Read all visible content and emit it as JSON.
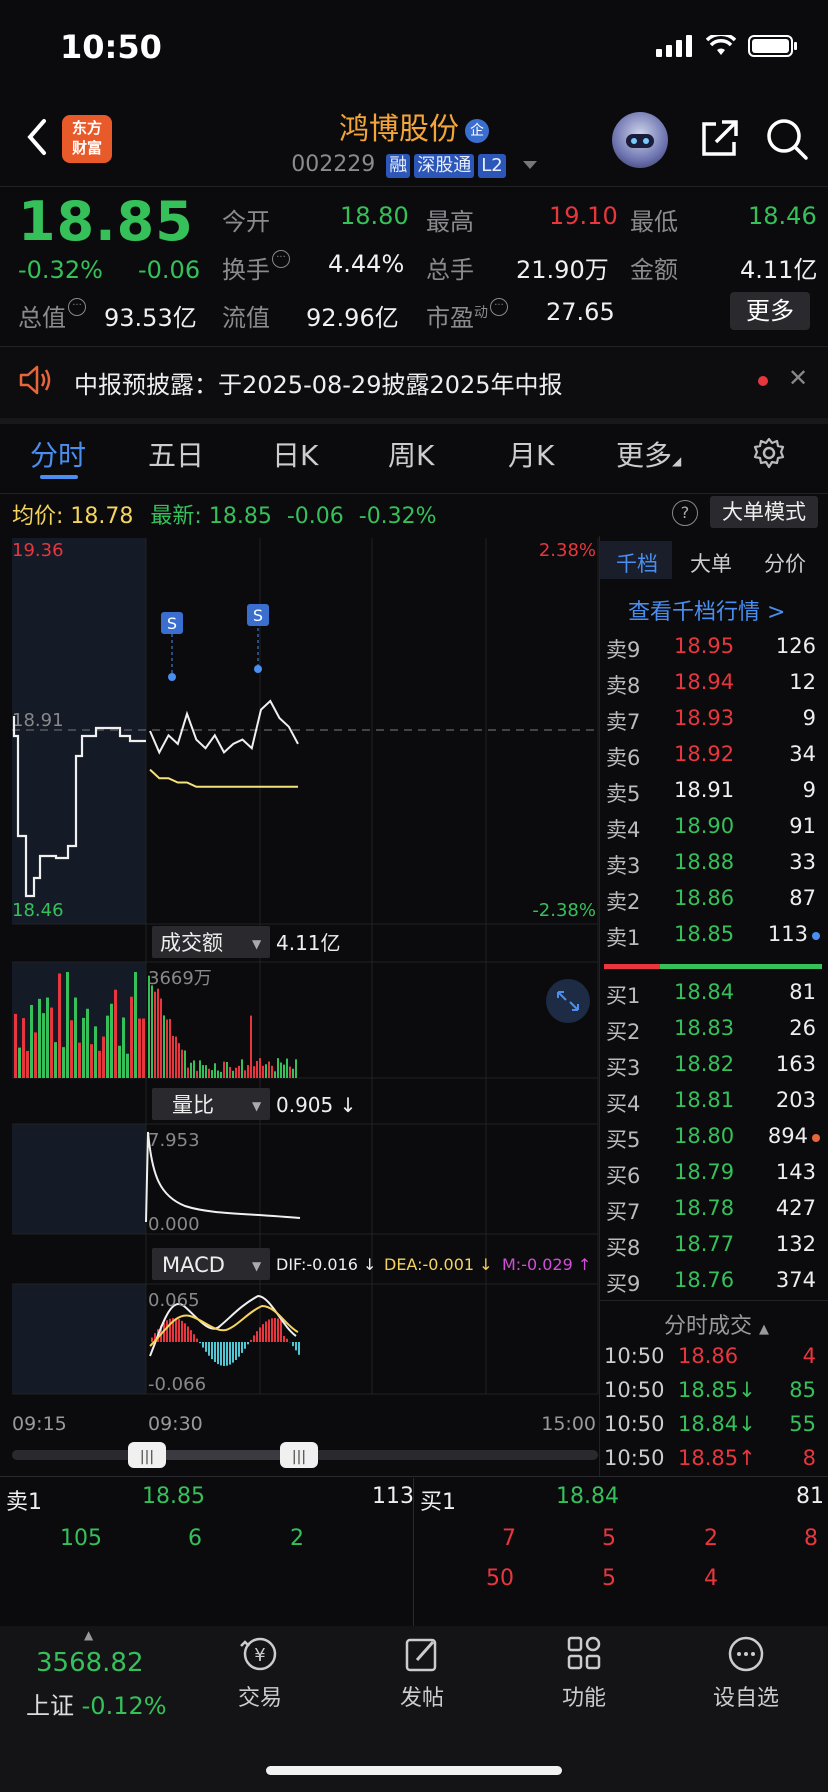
{
  "status_bar": {
    "time": "10:50"
  },
  "header": {
    "logo_line1": "东方",
    "logo_line2": "财富",
    "title": "鸿博股份",
    "title_badge": "企",
    "code": "002229",
    "tags": [
      "融",
      "深股通",
      "L2"
    ]
  },
  "quote": {
    "price": "18.85",
    "change_pct": "-0.32%",
    "change": "-0.06",
    "total_value_label": "总值",
    "total_value": "93.53亿",
    "fields": [
      {
        "label": "今开",
        "value": "18.80",
        "color": "green"
      },
      {
        "label": "最高",
        "value": "19.10",
        "color": "red"
      },
      {
        "label": "最低",
        "value": "18.46",
        "color": "green"
      },
      {
        "label": "换手",
        "value": "4.44%",
        "color": "white"
      },
      {
        "label": "总手",
        "value": "21.90万",
        "color": "white"
      },
      {
        "label": "金额",
        "value": "4.11亿",
        "color": "white"
      },
      {
        "label": "流值",
        "value": "92.96亿",
        "color": "white"
      },
      {
        "label": "市盈",
        "label_sup": "动",
        "value": "27.65",
        "color": "white"
      }
    ],
    "more_label": "更多"
  },
  "notice": {
    "text": "中报预披露：于2025-08-29披露2025年中报"
  },
  "tabs": [
    "分时",
    "五日",
    "日K",
    "周K",
    "月K",
    "更多"
  ],
  "summary": {
    "avg_label": "均价:",
    "avg_value": "18.78",
    "latest_label": "最新:",
    "latest_value": "18.85",
    "latest_change": "-0.06",
    "latest_pct": "-0.32%",
    "bigorder_label": "大单模式"
  },
  "chart": {
    "price_high": "19.36",
    "price_low": "18.46",
    "price_ref": "18.91",
    "pct_high": "2.38%",
    "pct_low": "-2.38%",
    "signal_label": "S",
    "vol_indicator": "成交额",
    "vol_value": "4.11亿",
    "vol_max": "3669万",
    "ratio_indicator": "量比",
    "ratio_value": "0.905 ↓",
    "ratio_max": "7.953",
    "ratio_min": "0.000",
    "macd_indicator": "MACD",
    "dif": "DIF:-0.016 ↓",
    "dea": "DEA:-0.001 ↓",
    "m": "M:-0.029 ↑",
    "macd_max": "0.065",
    "macd_min": "-0.066",
    "time_start": "09:15",
    "time_open": "09:30",
    "time_end": "15:00"
  },
  "chart_data": {
    "type": "line",
    "series": [
      {
        "name": "最新",
        "values": [
          18.91,
          18.86,
          18.9,
          18.88,
          18.95,
          18.89,
          18.87,
          18.9,
          18.86,
          18.88,
          18.89,
          18.87,
          18.96,
          18.98,
          18.94,
          18.92,
          18.88
        ]
      },
      {
        "name": "均价",
        "values": [
          18.82,
          18.8,
          18.8,
          18.79,
          18.79,
          18.78,
          18.78,
          18.78,
          18.78,
          18.78,
          18.78,
          18.78,
          18.78,
          18.78,
          18.78,
          18.78,
          18.78
        ]
      }
    ],
    "ylim": [
      18.46,
      19.36
    ]
  },
  "orderbook": {
    "tabs": [
      "千档",
      "大单",
      "分价"
    ],
    "link": "查看千档行情 >",
    "asks": [
      {
        "label": "卖9",
        "price": "18.95",
        "vol": "126",
        "color": "red"
      },
      {
        "label": "卖8",
        "price": "18.94",
        "vol": "12",
        "color": "red"
      },
      {
        "label": "卖7",
        "price": "18.93",
        "vol": "9",
        "color": "red"
      },
      {
        "label": "卖6",
        "price": "18.92",
        "vol": "34",
        "color": "red"
      },
      {
        "label": "卖5",
        "price": "18.91",
        "vol": "9",
        "color": "white"
      },
      {
        "label": "卖4",
        "price": "18.90",
        "vol": "91",
        "color": "green"
      },
      {
        "label": "卖3",
        "price": "18.88",
        "vol": "33",
        "color": "green"
      },
      {
        "label": "卖2",
        "price": "18.86",
        "vol": "87",
        "color": "green"
      },
      {
        "label": "卖1",
        "price": "18.85",
        "vol": "113",
        "color": "green"
      }
    ],
    "bids": [
      {
        "label": "买1",
        "price": "18.84",
        "vol": "81",
        "color": "green"
      },
      {
        "label": "买2",
        "price": "18.83",
        "vol": "26",
        "color": "green"
      },
      {
        "label": "买3",
        "price": "18.82",
        "vol": "163",
        "color": "green"
      },
      {
        "label": "买4",
        "price": "18.81",
        "vol": "203",
        "color": "green"
      },
      {
        "label": "买5",
        "price": "18.80",
        "vol": "894",
        "color": "green"
      },
      {
        "label": "买6",
        "price": "18.79",
        "vol": "143",
        "color": "green"
      },
      {
        "label": "买7",
        "price": "18.78",
        "vol": "427",
        "color": "green"
      },
      {
        "label": "买8",
        "price": "18.77",
        "vol": "132",
        "color": "green"
      },
      {
        "label": "买9",
        "price": "18.76",
        "vol": "374",
        "color": "green"
      }
    ],
    "ticks_title": "分时成交",
    "ticks": [
      {
        "time": "10:50",
        "price": "18.86",
        "vol": "4",
        "color": "red"
      },
      {
        "time": "10:50",
        "price": "18.85↓",
        "vol": "85",
        "color": "green"
      },
      {
        "time": "10:50",
        "price": "18.84↓",
        "vol": "55",
        "color": "green"
      },
      {
        "time": "10:50",
        "price": "18.85↑",
        "vol": "8",
        "color": "red"
      }
    ]
  },
  "levels": {
    "sell_label": "卖1",
    "sell_price": "18.85",
    "sell_vol": "113",
    "buy_label": "买1",
    "buy_price": "18.84",
    "buy_vol": "81",
    "sell_queue": [
      "105",
      "6",
      "2"
    ],
    "buy_queue_row1": [
      "7",
      "5",
      "2",
      "8"
    ],
    "buy_queue_row2": [
      "50",
      "5",
      "4"
    ]
  },
  "nav": {
    "index_value": "3568.82",
    "index_name": "上证",
    "index_change": "-0.12%",
    "items": [
      "交易",
      "发帖",
      "功能",
      "设自选"
    ]
  }
}
